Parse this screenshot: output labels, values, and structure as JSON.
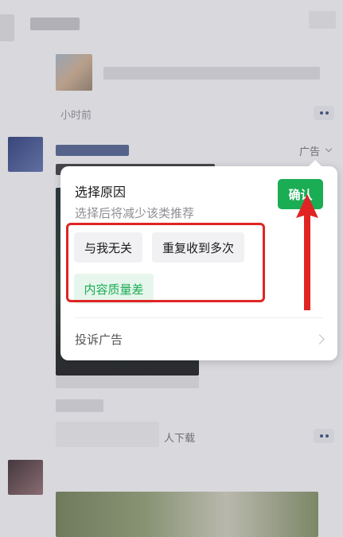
{
  "feed": {
    "time_label": "小时前",
    "ad_label": "广告",
    "bottom_text": "人下载"
  },
  "popup": {
    "title": "选择原因",
    "subtitle": "选择后将减少该类推荐",
    "confirm_label": "确认",
    "reasons": [
      {
        "label": "与我无关",
        "selected": false
      },
      {
        "label": "重复收到多次",
        "selected": false
      },
      {
        "label": "内容质量差",
        "selected": true
      }
    ],
    "complain_label": "投诉广告"
  },
  "annotation": {
    "color": "#e02424"
  },
  "colors": {
    "accent": "#1aad54",
    "selected_bg": "#e7f6ec"
  }
}
